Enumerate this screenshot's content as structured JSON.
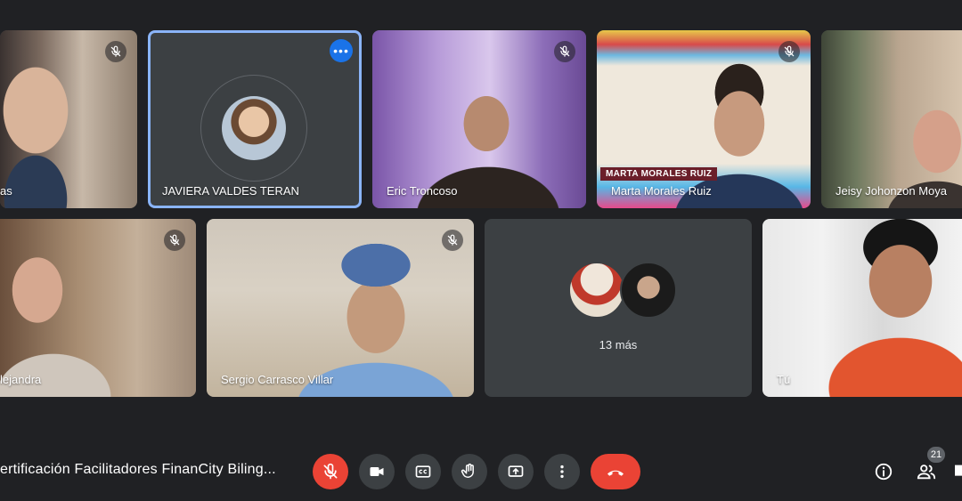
{
  "participants": [
    {
      "name": "as",
      "muted": true
    },
    {
      "name": "JAVIERA VALDES TERAN",
      "muted": false,
      "focused": true
    },
    {
      "name": "Eric Troncoso",
      "muted": true
    },
    {
      "name": "Marta Morales Ruiz",
      "muted": true,
      "overlay_label": "MARTA MORALES RUIZ"
    },
    {
      "name": "Jeisy Johonzon Moya",
      "muted": false
    },
    {
      "name": "lejandra",
      "muted": true
    },
    {
      "name": "Sergio Carrasco Villar",
      "muted": true
    },
    {
      "name": "Tú",
      "muted": false
    }
  ],
  "overflow": {
    "label": "13 más"
  },
  "meeting": {
    "title": "ertificación Facilitadores FinanCity Biling..."
  },
  "controls": {
    "mic": "mic-off-icon",
    "camera": "camera-icon",
    "captions": "closed-captions-icon",
    "hand": "raise-hand-icon",
    "present": "present-screen-icon",
    "more": "more-options-icon",
    "end": "end-call-icon"
  },
  "right_panel": {
    "info": "info-icon",
    "people": "people-icon",
    "people_count": "21"
  },
  "colors": {
    "background": "#202124",
    "tile": "#3c4043",
    "red": "#ea4335",
    "focus": "#8ab4f8",
    "blue": "#1a73e8"
  }
}
